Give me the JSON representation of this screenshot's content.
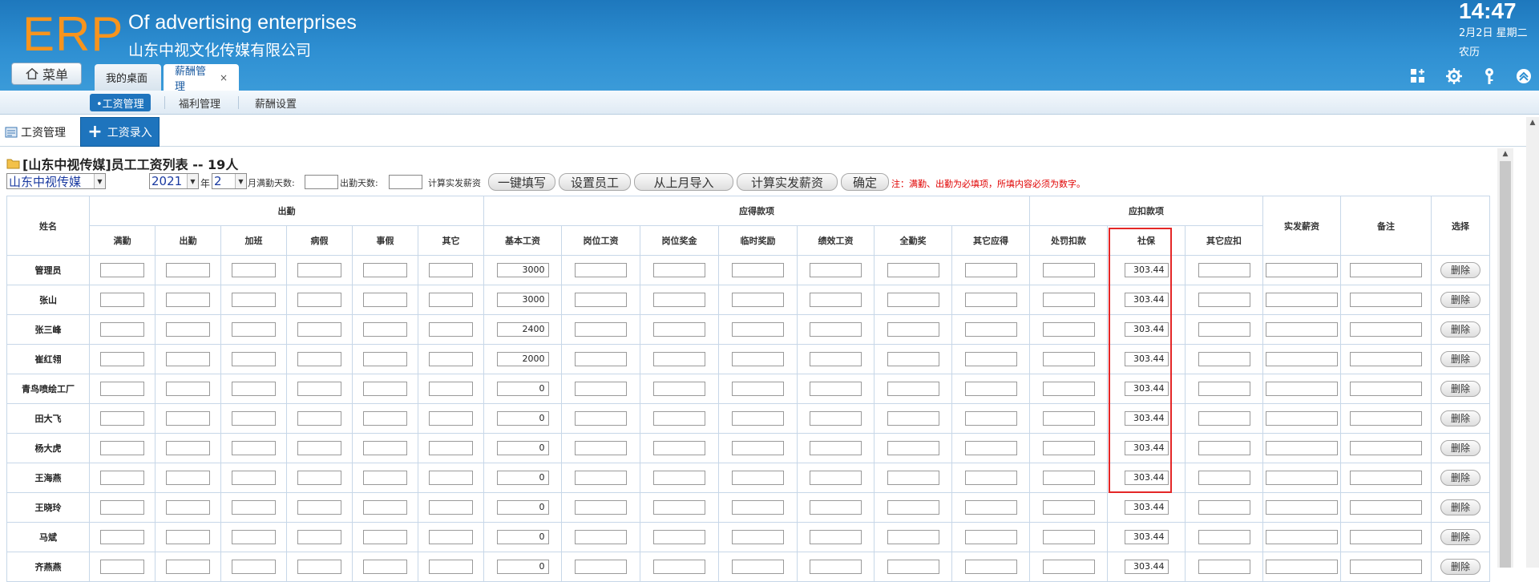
{
  "header": {
    "logo": "ERP",
    "company_en": "Of advertising enterprises",
    "company_cn": "山东中视文化传媒有限公司",
    "time": "14:47",
    "date": "2月2日 星期二",
    "lunar": "农历",
    "menu_label": "菜单",
    "tabs": [
      {
        "label": "我的桌面"
      },
      {
        "label": "薪酬管理",
        "close": "×"
      }
    ],
    "icons": [
      "grid-plus-icon",
      "gear-icon",
      "key-icon",
      "collapse-up-icon"
    ]
  },
  "subnav": {
    "items": [
      {
        "label": "•工资管理",
        "active": true
      },
      {
        "label": "福利管理"
      },
      {
        "label": "薪酬设置"
      }
    ]
  },
  "module": {
    "tab_label": "工资管理",
    "add_label": "工资录入"
  },
  "list": {
    "title": "[山东中视传媒]员工工资列表 -- 19人"
  },
  "filters": {
    "company": "山东中视传媒",
    "year": "2021",
    "year_unit": "年",
    "month": "2",
    "full_days_label": "月满勤天数:",
    "attend_days_label": "出勤天数:",
    "calc_label": "计算实发薪资",
    "buttons": [
      "一键填写",
      "设置员工",
      "从上月导入",
      "计算实发薪资",
      "确定"
    ],
    "note": "注：满勤、出勤为必填项，所填内容必须为数字。"
  },
  "table": {
    "name_header": "姓名",
    "groups": {
      "attendance": "出勤",
      "payable": "应得款项",
      "deduction": "应扣款项",
      "net": "实发薪资",
      "remark": "备注",
      "select": "选择"
    },
    "subcolumns": [
      "满勤",
      "出勤",
      "加班",
      "病假",
      "事假",
      "其它",
      "基本工资",
      "岗位工资",
      "岗位奖金",
      "临时奖励",
      "绩效工资",
      "全勤奖",
      "其它应得",
      "处罚扣款",
      "社保",
      "其它应扣"
    ],
    "delete_label": "删除",
    "rows": [
      {
        "name": "管理员",
        "base": "3000",
        "social": "303.44"
      },
      {
        "name": "张山",
        "base": "3000",
        "social": "303.44"
      },
      {
        "name": "张三峰",
        "base": "2400",
        "social": "303.44"
      },
      {
        "name": "崔红翎",
        "base": "2000",
        "social": "303.44"
      },
      {
        "name": "青鸟喷绘工厂",
        "base": "0",
        "social": "303.44"
      },
      {
        "name": "田大飞",
        "base": "0",
        "social": "303.44"
      },
      {
        "name": "杨大虎",
        "base": "0",
        "social": "303.44"
      },
      {
        "name": "王海燕",
        "base": "0",
        "social": "303.44"
      },
      {
        "name": "王晓玲",
        "base": "0",
        "social": "303.44"
      },
      {
        "name": "马斌",
        "base": "0",
        "social": "303.44"
      },
      {
        "name": "齐燕燕",
        "base": "0",
        "social": "303.44"
      }
    ]
  },
  "colors": {
    "header_blue": "#2e8fd2",
    "logo_orange": "#f7941d",
    "highlight_red": "#e42727",
    "note_red": "#e00000"
  }
}
